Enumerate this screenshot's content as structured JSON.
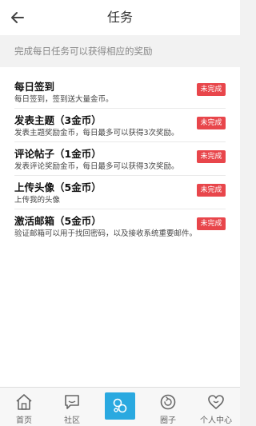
{
  "header": {
    "title": "任务"
  },
  "banner": {
    "text": "完成每日任务可以获得相应的奖励"
  },
  "tasks": [
    {
      "name": "每日签到",
      "desc": "每日签到，签到送大量金币。",
      "status": "未完成"
    },
    {
      "name": "发表主题（3金币）",
      "desc": "发表主题奖励金币，每日最多可以获得3次奖励。",
      "status": "未完成"
    },
    {
      "name": "评论帖子（1金币）",
      "desc": "发表评论奖励金币，每日最多可以获得3次奖励。",
      "status": "未完成"
    },
    {
      "name": "上传头像（5金币）",
      "desc": "上传我的头像",
      "status": "未完成"
    },
    {
      "name": "激活邮箱（5金币）",
      "desc": "验证邮箱可以用于找回密码，以及接收系统重要邮件。",
      "status": "未完成"
    }
  ],
  "tabbar": {
    "items": [
      {
        "label": "首页",
        "icon": "home-icon"
      },
      {
        "label": "社区",
        "icon": "chat-icon"
      },
      {
        "label": "",
        "icon": "bubbles-icon"
      },
      {
        "label": "圈子",
        "icon": "refresh-icon"
      },
      {
        "label": "个人中心",
        "icon": "heart-smile-icon"
      }
    ]
  },
  "colors": {
    "badge": "#e8464b",
    "accent": "#2aa9e0"
  }
}
